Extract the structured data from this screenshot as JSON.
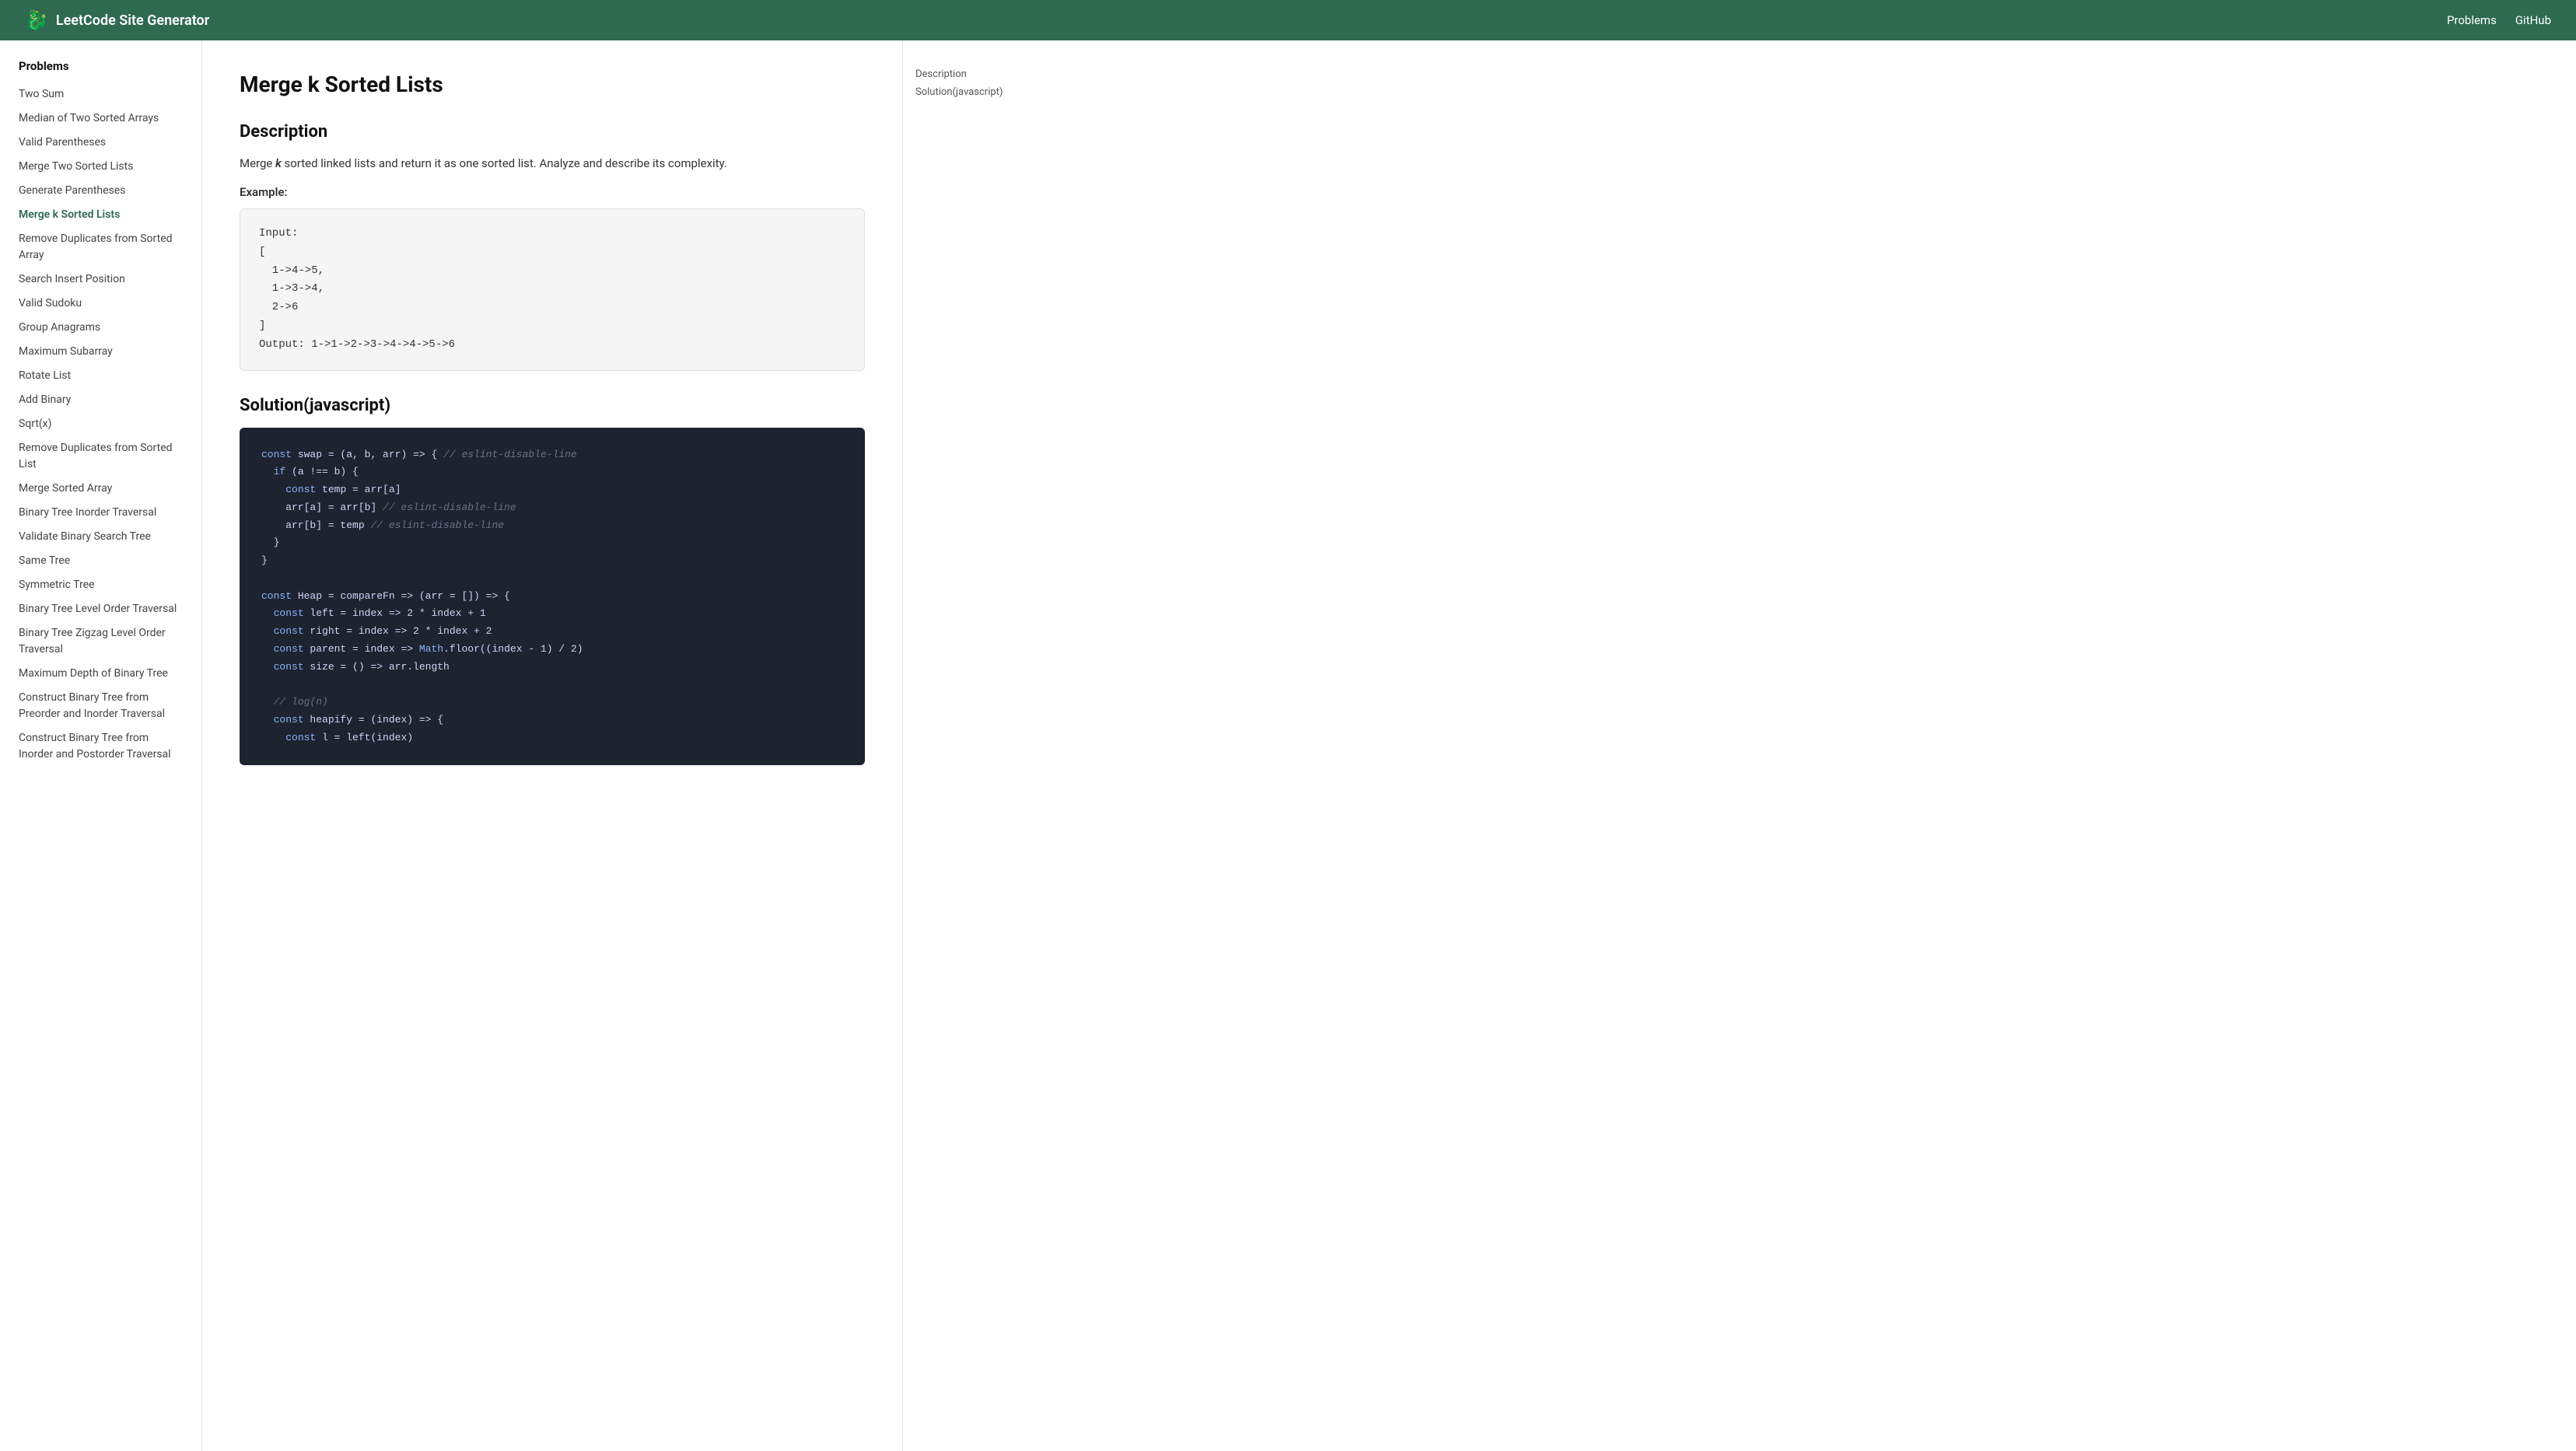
{
  "header": {
    "brand_icon": "🐉",
    "brand_name": "LeetCode Site Generator",
    "nav": [
      {
        "label": "Problems",
        "href": "#"
      },
      {
        "label": "GitHub",
        "href": "#"
      }
    ]
  },
  "sidebar": {
    "title": "Problems",
    "items": [
      {
        "label": "Two Sum",
        "active": false
      },
      {
        "label": "Median of Two Sorted Arrays",
        "active": false
      },
      {
        "label": "Valid Parentheses",
        "active": false
      },
      {
        "label": "Merge Two Sorted Lists",
        "active": false
      },
      {
        "label": "Generate Parentheses",
        "active": false
      },
      {
        "label": "Merge k Sorted Lists",
        "active": true
      },
      {
        "label": "Remove Duplicates from Sorted Array",
        "active": false
      },
      {
        "label": "Search Insert Position",
        "active": false
      },
      {
        "label": "Valid Sudoku",
        "active": false
      },
      {
        "label": "Group Anagrams",
        "active": false
      },
      {
        "label": "Maximum Subarray",
        "active": false
      },
      {
        "label": "Rotate List",
        "active": false
      },
      {
        "label": "Add Binary",
        "active": false
      },
      {
        "label": "Sqrt(x)",
        "active": false
      },
      {
        "label": "Remove Duplicates from Sorted List",
        "active": false
      },
      {
        "label": "Merge Sorted Array",
        "active": false
      },
      {
        "label": "Binary Tree Inorder Traversal",
        "active": false
      },
      {
        "label": "Validate Binary Search Tree",
        "active": false
      },
      {
        "label": "Same Tree",
        "active": false
      },
      {
        "label": "Symmetric Tree",
        "active": false
      },
      {
        "label": "Binary Tree Level Order Traversal",
        "active": false
      },
      {
        "label": "Binary Tree Zigzag Level Order Traversal",
        "active": false
      },
      {
        "label": "Maximum Depth of Binary Tree",
        "active": false
      },
      {
        "label": "Construct Binary Tree from Preorder and Inorder Traversal",
        "active": false
      },
      {
        "label": "Construct Binary Tree from Inorder and Postorder Traversal",
        "active": false
      }
    ]
  },
  "main": {
    "page_title": "Merge k Sorted Lists",
    "description_section": {
      "title": "Description",
      "text_before_italic": "Merge ",
      "italic_text": "k",
      "text_after_italic": " sorted linked lists and return it as one sorted list. Analyze and describe its complexity.",
      "example_label": "Example:",
      "code_input": "Input:\n[\n  1->4->5,\n  1->3->4,\n  2->6\n]\nOutput: 1->1->2->3->4->4->5->6"
    },
    "solution_section": {
      "title": "Solution(javascript)",
      "code": "const swap = (a, b, arr) => { // eslint-disable-line\n  if (a !== b) {\n    const temp = arr[a]\n    arr[a] = arr[b] // eslint-disable-line\n    arr[b] = temp // eslint-disable-line\n  }\n}\n\nconst Heap = compareFn => (arr = []) => {\n  const left = index => 2 * index + 1\n  const right = index => 2 * index + 2\n  const parent = index => Math.floor((index - 1) / 2)\n  const size = () => arr.length\n\n  // log(n)\n  const heapify = (index) => {\n    const l = left(index)"
    }
  },
  "toc": {
    "items": [
      {
        "label": "Description"
      },
      {
        "label": "Solution(javascript)"
      }
    ]
  }
}
